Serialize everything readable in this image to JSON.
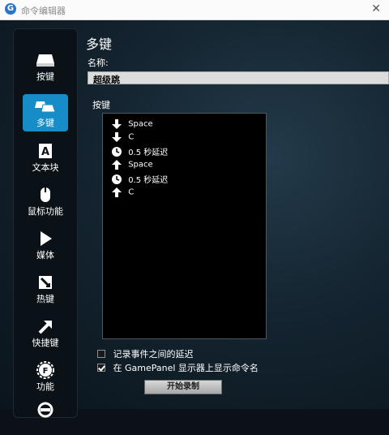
{
  "window": {
    "title": "命令编辑器",
    "close_glyph": "✕",
    "logo_glyph": "G"
  },
  "sidebar": {
    "items": [
      {
        "label": "按键",
        "icon": "keycap-icon",
        "active": false
      },
      {
        "label": "多键",
        "icon": "multi-key-icon",
        "active": true
      },
      {
        "label": "文本块",
        "icon": "text-block-icon",
        "active": false
      },
      {
        "label": "鼠标功能",
        "icon": "mouse-icon",
        "active": false
      },
      {
        "label": "媒体",
        "icon": "play-icon",
        "active": false
      },
      {
        "label": "热键",
        "icon": "hotkey-icon",
        "active": false
      },
      {
        "label": "快捷键",
        "icon": "shortcut-arrow-icon",
        "active": false
      },
      {
        "label": "功能",
        "icon": "function-gear-icon",
        "active": false
      },
      {
        "label": "",
        "icon": "more-icon",
        "active": false
      }
    ]
  },
  "main": {
    "title": "多键",
    "name_label": "名称:",
    "name_value": "超级跳",
    "keys_label": "按键",
    "key_events": [
      {
        "type": "down",
        "text": "Space"
      },
      {
        "type": "down",
        "text": "C"
      },
      {
        "type": "delay",
        "text": "0.5 秒延迟"
      },
      {
        "type": "up",
        "text": "Space"
      },
      {
        "type": "delay",
        "text": "0.5 秒延迟"
      },
      {
        "type": "up",
        "text": "C"
      }
    ],
    "options": [
      {
        "label": "记录事件之间的延迟",
        "checked": false
      },
      {
        "label": "在 GamePanel 显示器上显示命令名",
        "checked": true
      }
    ],
    "record_button": "开始录制"
  }
}
